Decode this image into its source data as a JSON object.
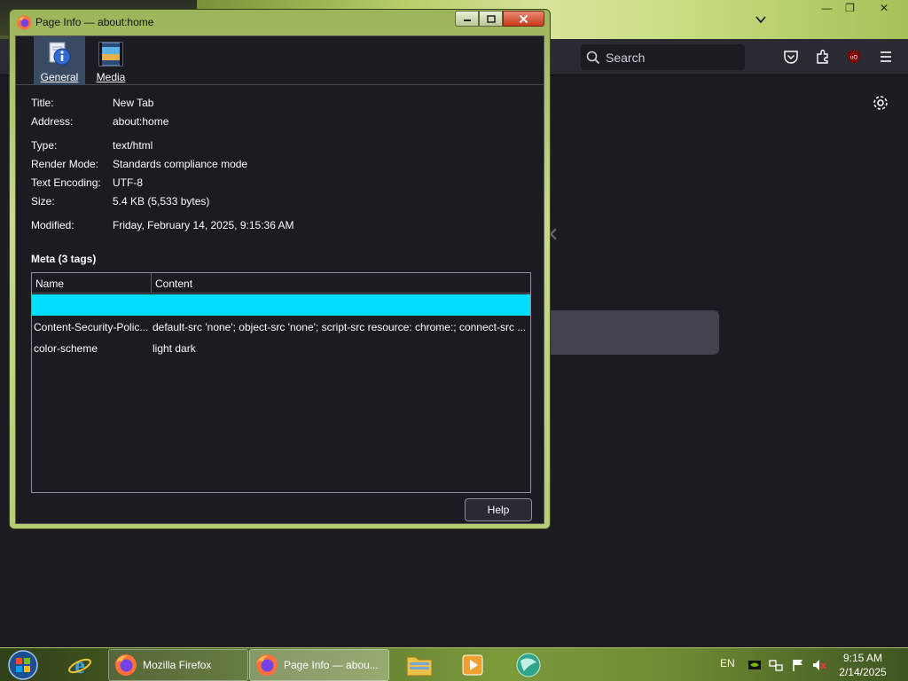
{
  "browser": {
    "search_placeholder": "Search",
    "window_controls": {
      "minimize": "—",
      "maximize": "❐",
      "close": "✕"
    }
  },
  "dialog": {
    "title": "Page Info — about:home",
    "tabs": [
      {
        "label": "General",
        "icon": "info-icon",
        "selected": true
      },
      {
        "label": "Media",
        "icon": "media-icon",
        "selected": false
      }
    ],
    "general": {
      "title": {
        "label": "Title:",
        "value": "New Tab"
      },
      "address": {
        "label": "Address:",
        "value": "about:home"
      },
      "type": {
        "label": "Type:",
        "value": "text/html"
      },
      "render_mode": {
        "label": "Render Mode:",
        "value": "Standards compliance mode"
      },
      "text_encoding": {
        "label": "Text Encoding:",
        "value": "UTF-8"
      },
      "size": {
        "label": "Size:",
        "value": "5.4 KB (5,533 bytes)"
      },
      "modified": {
        "label": "Modified:",
        "value": "Friday, February 14, 2025, 9:15:36 AM"
      }
    },
    "meta": {
      "heading": "Meta (3 tags)",
      "columns": [
        "Name",
        "Content"
      ],
      "selection_color": "#00ddff",
      "rows": [
        {
          "name": "",
          "content": ""
        },
        {
          "name": "Content-Security-Polic...",
          "content": "default-src 'none'; object-src 'none'; script-src resource: chrome:; connect-src ..."
        },
        {
          "name": "color-scheme",
          "content": "light dark"
        }
      ]
    },
    "help_label": "Help"
  },
  "taskbar": {
    "tasks": [
      {
        "label": "Mozilla Firefox"
      },
      {
        "label": "Page Info — abou..."
      }
    ],
    "language": "EN",
    "time": "9:15 AM",
    "date": "2/14/2025"
  },
  "colors": {
    "dark_bg": "#1c1b22",
    "toolbar_bg": "#2b2a33",
    "text": "#fbfbfe",
    "accent": "#00ddff"
  }
}
